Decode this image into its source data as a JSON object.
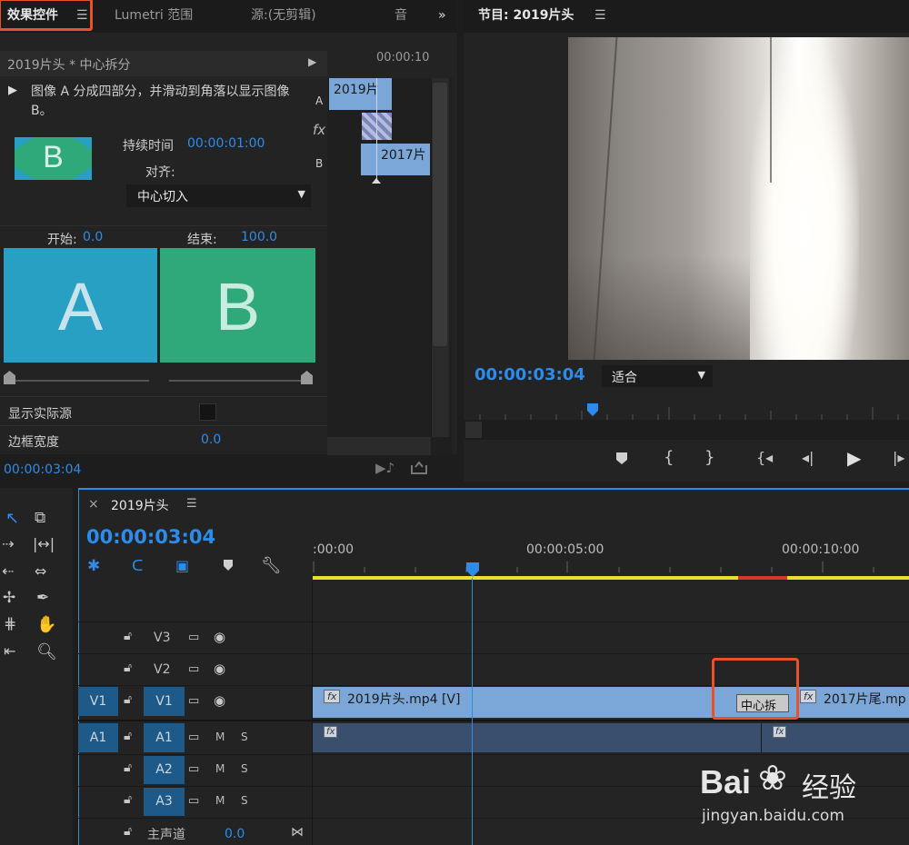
{
  "colors": {
    "accent": "#2d8ceb",
    "highlight_box": "#e8522a",
    "clip_video": "#7aa6d8",
    "clip_audio": "#3a4f6e",
    "a_tile": "#27a0c4",
    "b_tile": "#2fa87a"
  },
  "effect_controls": {
    "tabs": [
      "效果控件",
      "Lumetri 范围",
      "源:(无剪辑)",
      "音"
    ],
    "tab_menu": "☰",
    "overflow": "»",
    "clip_header": "2019片头 * 中心拆分",
    "description": "图像 A 分成四部分，并滑动到角落以显示图像 B。",
    "duration_label": "持续时间",
    "duration_value": "00:00:01:00",
    "align_label": "对齐:",
    "align_value": "中心切入",
    "start_label": "开始:",
    "start_value": "0.0",
    "end_label": "结束:",
    "end_value": "100.0",
    "a_letter": "A",
    "b_letter": "B",
    "thumb_letter": "B",
    "show_actual_label": "显示实际源",
    "border_width_label": "边框宽度",
    "border_width_value": "0.0",
    "footer_timecode": "00:00:03:04",
    "mini_timeline": {
      "ruler": "00:00:10",
      "row_a": "A",
      "row_fx": "fx",
      "row_b": "B",
      "clip_a": "2019片",
      "clip_b": "2017片"
    }
  },
  "program_monitor": {
    "title": "节目: 2019片头",
    "timecode": "00:00:03:04",
    "fit_value": "适合",
    "playhead_fraction": 0.29
  },
  "timeline": {
    "close": "×",
    "sequence_name": "2019片头",
    "timecode": "00:00:03:04",
    "ruler_labels": [
      ":00:00",
      "00:00:05:00",
      "00:00:10:00"
    ],
    "tracks": {
      "v3": "V3",
      "v2": "V2",
      "v1_src": "V1",
      "v1": "V1",
      "a1_src": "A1",
      "a1": "A1",
      "a2": "A2",
      "a3": "A3",
      "master": "主声道",
      "master_value": "0.0",
      "m": "M",
      "s": "S"
    },
    "clip_v1_a": "2019片头.mp4 [V]",
    "clip_v1_b": "2017片尾.mp",
    "transition_label": "中心拆",
    "fx": "fx"
  },
  "watermark": {
    "brand": "Bai",
    "brand_cn": "经验",
    "url": "jingyan.baidu.com"
  }
}
